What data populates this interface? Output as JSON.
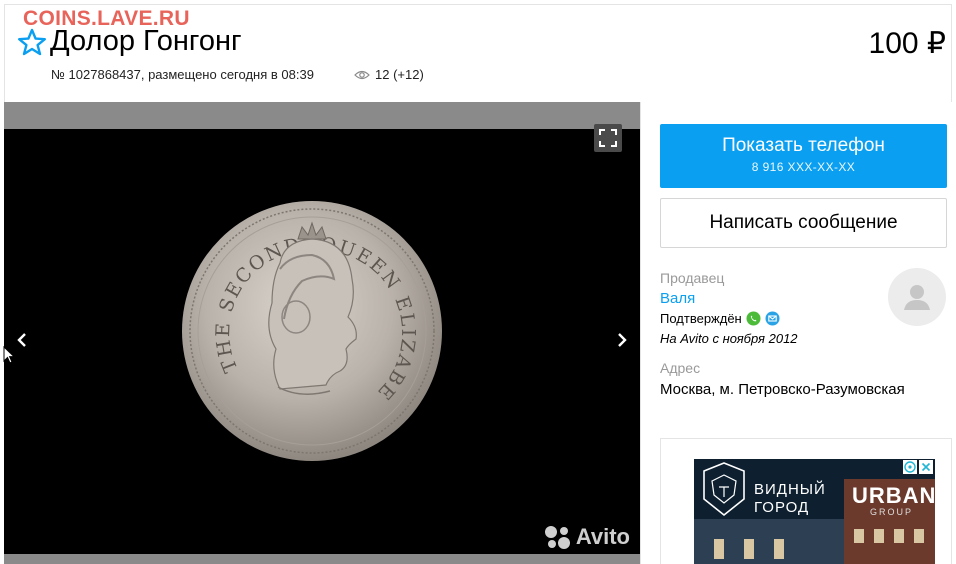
{
  "watermark": "COINS.LAVE.RU",
  "listing": {
    "title": "Долор Гонгонг",
    "price": "100 ₽",
    "meta": "№ 1027868437, размещено сегодня в 08:39",
    "views": "12 (+12)"
  },
  "gallery": {
    "coin_legend": "THE SECOND QUEEN ELIZABETH",
    "avito_watermark": "Avito"
  },
  "contact": {
    "phone_label": "Показать телефон",
    "phone_masked": "8 916 XXX-XX-XX",
    "message_label": "Написать сообщение"
  },
  "seller": {
    "label": "Продавец",
    "name": "Валя",
    "verified": "Подтверждён",
    "since": "На Avito с ноября 2012"
  },
  "address": {
    "label": "Адрес",
    "value": "Москва, м. Петровско-Разумовская"
  },
  "ad": {
    "line1": "ВИДНЫЙ",
    "line2": "ГОРОД",
    "brand": "URBAN",
    "brand_sub": "GROUP"
  },
  "colors": {
    "accent": "#0a9ff0",
    "watermark": "#e8645a",
    "whatsapp": "#4cbb3a",
    "mail": "#2aa3e6"
  },
  "icons": [
    "star-icon",
    "eye-icon",
    "expand-icon",
    "chevron-left-icon",
    "chevron-right-icon",
    "avito-logo-icon",
    "whatsapp-icon",
    "mail-icon",
    "user-avatar-icon",
    "adchoices-icon",
    "close-icon",
    "lion-logo-icon"
  ]
}
